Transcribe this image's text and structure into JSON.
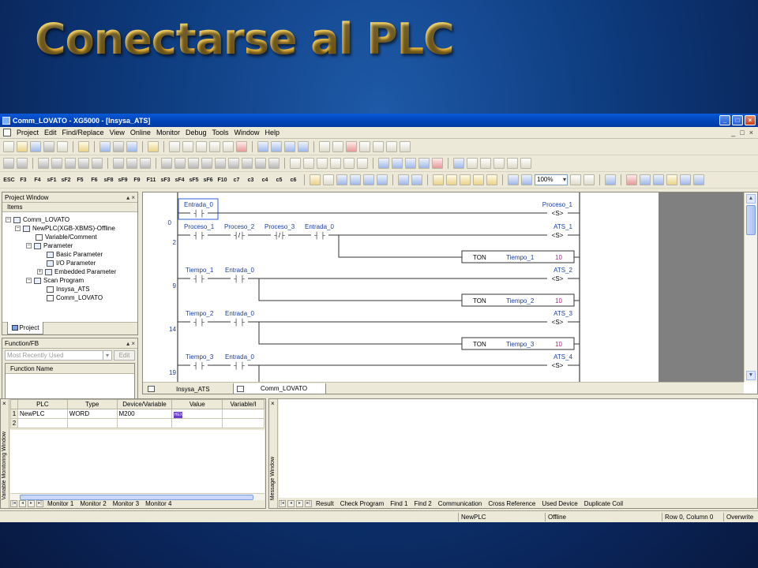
{
  "slide_title": "Conectarse al PLC",
  "window": {
    "title": "Comm_LOVATO - XG5000 - [Insysa_ATS]",
    "buttons": [
      "_",
      "□",
      "×"
    ]
  },
  "menubar": {
    "items": [
      "Project",
      "Edit",
      "Find/Replace",
      "View",
      "Online",
      "Monitor",
      "Debug",
      "Tools",
      "Window",
      "Help"
    ],
    "mdi_controls": [
      "_",
      "□",
      "×"
    ]
  },
  "toolbar": {
    "fkeys": [
      "ESC",
      "F3",
      "F4",
      "sF1",
      "sF2",
      "F5",
      "F6",
      "sF8",
      "sF9",
      "F9",
      "F11",
      "sF3",
      "sF4",
      "sF5",
      "sF6",
      "F10",
      "c7",
      "c3",
      "c4",
      "c5",
      "c6"
    ],
    "zoom": "100%"
  },
  "project_window": {
    "title": "Project Window",
    "controls": "▴ ×",
    "items_header": "Items",
    "tree": [
      "Comm_LOVATO",
      "NewPLC(XGB-XBMS)-Offline",
      "Variable/Comment",
      "Parameter",
      "Basic Parameter",
      "I/O Parameter",
      "Embedded Parameter",
      "Scan Program",
      "Insysa_ATS",
      "Comm_LOVATO"
    ],
    "tab": "Project"
  },
  "function_fb": {
    "title": "Function/FB",
    "controls": "▴ ×",
    "select_value": "Most Recently Used",
    "edit_label": "Edit",
    "list_header": "Function Name"
  },
  "ladder": {
    "steps": [
      "0",
      "2",
      "9",
      "14",
      "19"
    ],
    "contacts": [
      "Entrada_0",
      "Proceso_1",
      "Proceso_2",
      "Proceso_3",
      "Entrada_0",
      "Tiempo_1",
      "Entrada_0",
      "Tiempo_2",
      "Entrada_0",
      "Tiempo_3",
      "Entrada_0"
    ],
    "contact_symbols": [
      "┤ ├",
      "┤/├"
    ],
    "coils": [
      "Proceso_1",
      "ATS_1",
      "ATS_2",
      "ATS_3",
      "ATS_4"
    ],
    "coil_symbol": "<S>",
    "timers": [
      {
        "type": "TON",
        "name": "Tiempo_1",
        "value": "10"
      },
      {
        "type": "TON",
        "name": "Tiempo_2",
        "value": "10"
      },
      {
        "type": "TON",
        "name": "Tiempo_3",
        "value": "10"
      }
    ]
  },
  "editor_tabs": [
    "Insysa_ATS",
    "Comm_LOVATO"
  ],
  "variable_monitor": {
    "side_label": "Variable Monitoring Window",
    "columns": [
      "PLC",
      "Type",
      "Device/Variable",
      "Value",
      "Variable/I"
    ],
    "rows": [
      {
        "num": "1",
        "plc": "NewPLC",
        "type": "WORD",
        "device": "M200",
        "value": "HEX"
      },
      {
        "num": "2",
        "plc": "",
        "type": "",
        "device": "",
        "value": ""
      }
    ],
    "tabs": [
      "Monitor 1",
      "Monitor 2",
      "Monitor 3",
      "Monitor 4"
    ]
  },
  "message_window": {
    "side_label": "Message Window",
    "tabs": [
      "Result",
      "Check Program",
      "Find 1",
      "Find 2",
      "Communication",
      "Cross Reference",
      "Used Device",
      "Duplicate Coil"
    ]
  },
  "statusbar": {
    "plc": "NewPLC",
    "mode": "Offline",
    "position": "Row 0, Column 0",
    "insert_mode": "Overwrite"
  }
}
